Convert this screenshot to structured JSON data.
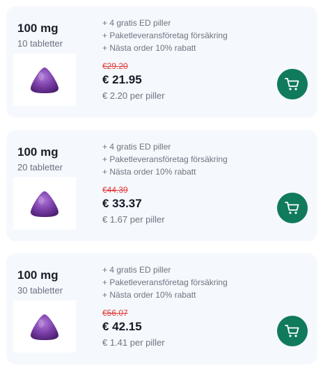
{
  "colors": {
    "card_bg": "#f5f8fc",
    "cart_button": "#107a5c",
    "old_price": "#e03a3a",
    "pill": "#7b3fa8"
  },
  "products": [
    {
      "dose": "100 mg",
      "count": "10 tabletter",
      "perks": [
        "+ 4 gratis ED piller",
        "+ Paketleveransföretag försäkring",
        "+ Nästa order 10% rabatt"
      ],
      "old_price": "€29.20",
      "price": "€ 21.95",
      "per_pill": "€ 2.20 per piller",
      "pill_icon": "purple-triangle-pill-icon",
      "cart_icon": "shopping-cart-icon"
    },
    {
      "dose": "100 mg",
      "count": "20 tabletter",
      "perks": [
        "+ 4 gratis ED piller",
        "+ Paketleveransföretag försäkring",
        "+ Nästa order 10% rabatt"
      ],
      "old_price": "€44.39",
      "price": "€ 33.37",
      "per_pill": "€ 1.67 per piller",
      "pill_icon": "purple-triangle-pill-icon",
      "cart_icon": "shopping-cart-icon"
    },
    {
      "dose": "100 mg",
      "count": "30 tabletter",
      "perks": [
        "+ 4 gratis ED piller",
        "+ Paketleveransföretag försäkring",
        "+ Nästa order 10% rabatt"
      ],
      "old_price": "€56.07",
      "price": "€ 42.15",
      "per_pill": "€ 1.41 per piller",
      "pill_icon": "purple-triangle-pill-icon",
      "cart_icon": "shopping-cart-icon"
    }
  ]
}
